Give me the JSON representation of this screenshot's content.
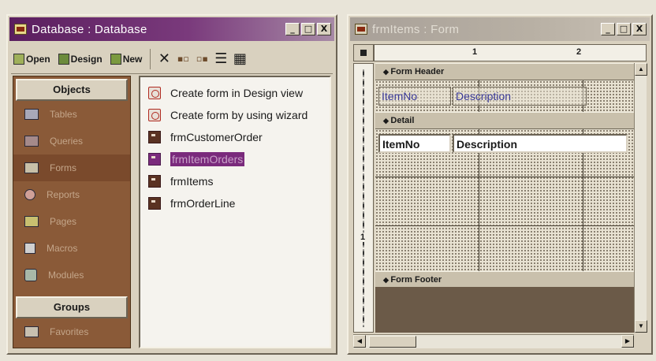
{
  "database_window": {
    "title": "Database : Database",
    "title_buttons": [
      "_",
      "□",
      "X"
    ],
    "toolbar": {
      "open_label": "Open",
      "design_label": "Design",
      "new_label": "New"
    },
    "objects_header": "Objects",
    "objects": [
      {
        "label": "Tables",
        "icon": "table-icon"
      },
      {
        "label": "Queries",
        "icon": "query-icon"
      },
      {
        "label": "Forms",
        "icon": "form-icon",
        "selected": true
      },
      {
        "label": "Reports",
        "icon": "report-icon"
      },
      {
        "label": "Pages",
        "icon": "page-icon"
      },
      {
        "label": "Macros",
        "icon": "macro-icon"
      },
      {
        "label": "Modules",
        "icon": "module-icon"
      }
    ],
    "groups_header": "Groups",
    "groups": [
      {
        "label": "Favorites",
        "icon": "favorites-icon"
      }
    ],
    "list_items": [
      {
        "label": "Create form in Design view",
        "icon": "wizard-icon"
      },
      {
        "label": "Create form by using wizard",
        "icon": "wizard-icon"
      },
      {
        "label": "frmCustomerOrder",
        "icon": "form-icon"
      },
      {
        "label": "frmItemOrders",
        "icon": "form-icon",
        "selected": true
      },
      {
        "label": "frmItems",
        "icon": "form-icon"
      },
      {
        "label": "frmOrderLine",
        "icon": "form-icon"
      }
    ]
  },
  "form_window": {
    "title": "frmItems : Form",
    "title_buttons": [
      "_",
      "□",
      "X"
    ],
    "ruler_numbers": [
      "1",
      "2"
    ],
    "vruler_number": "1",
    "sections": {
      "header": "Form Header",
      "detail": "Detail",
      "footer": "Form Footer"
    },
    "header_labels": [
      "ItemNo",
      "Description"
    ],
    "detail_fields": [
      "ItemNo",
      "Description"
    ]
  }
}
